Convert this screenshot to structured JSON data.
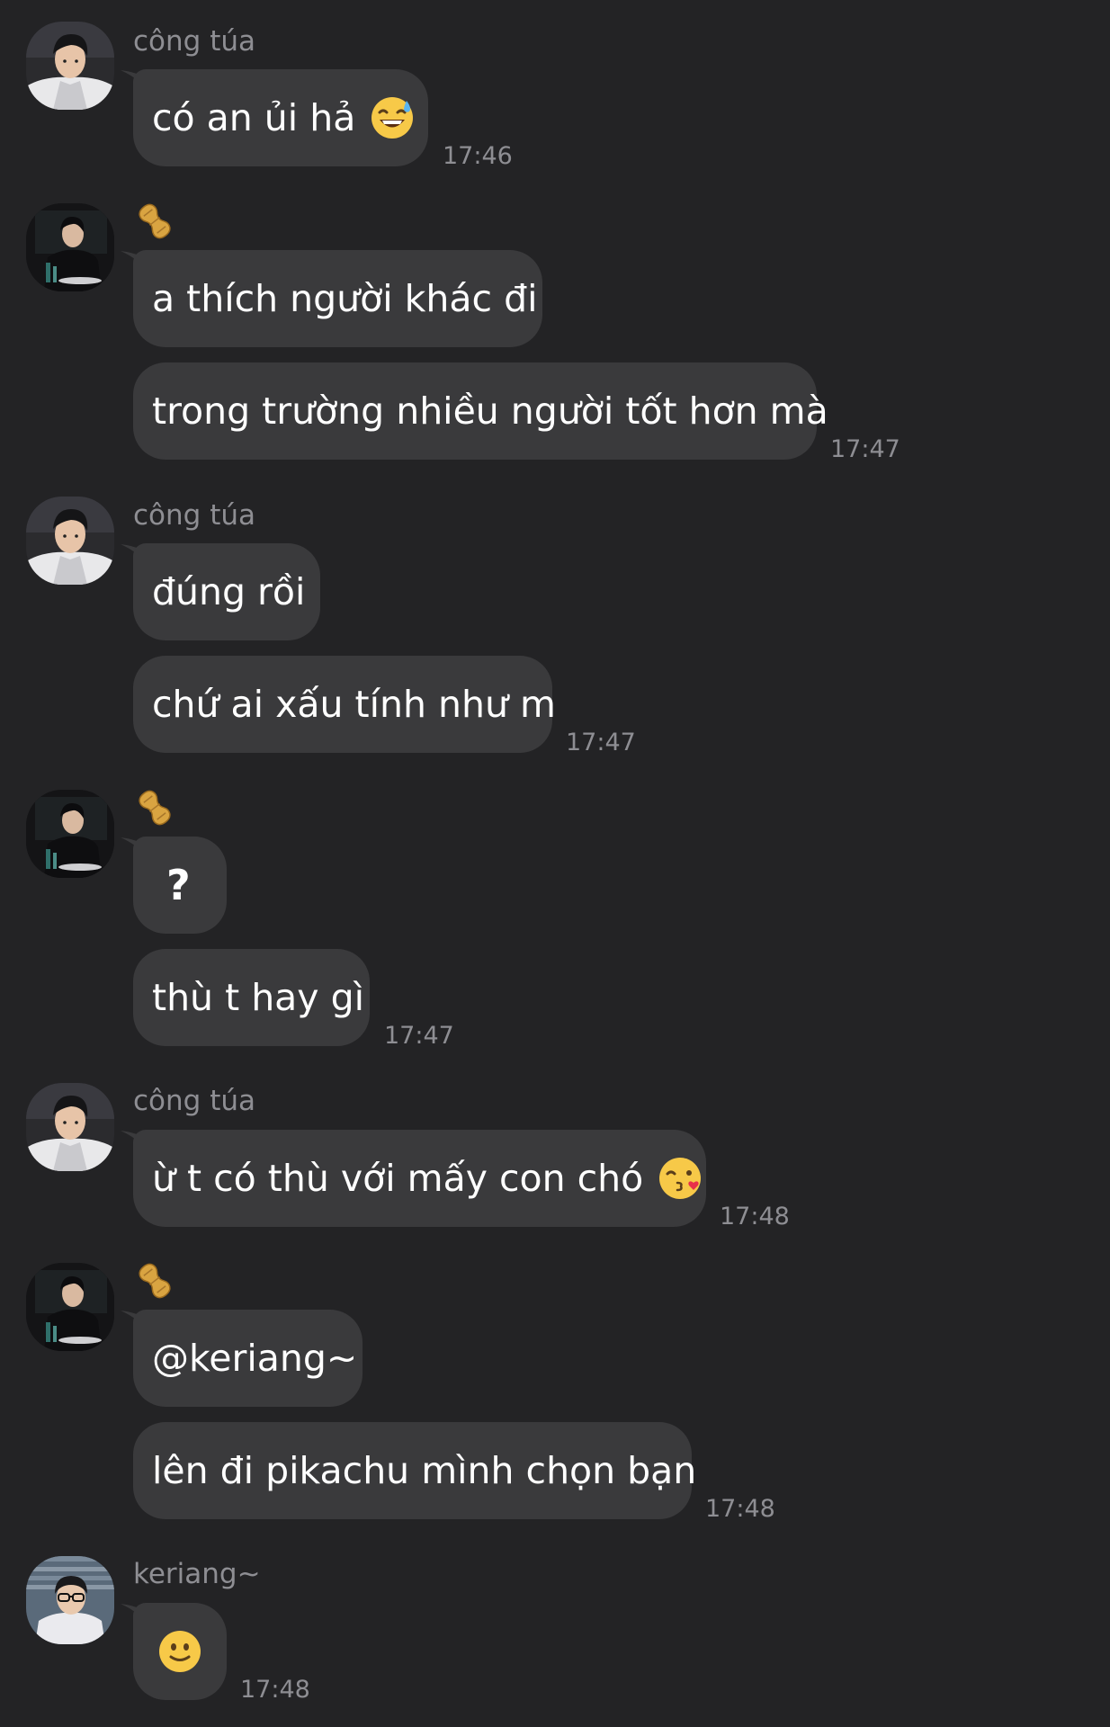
{
  "colors": {
    "background": "#232325",
    "bubble": "#3a3a3c",
    "meta_text": "#8e8e93",
    "message_text": "#ffffff"
  },
  "senders": {
    "cong_tua": {
      "name": "công túa",
      "avatar": "avatar-photo-cong-tua"
    },
    "peanut": {
      "name": "",
      "badge_icon": "peanut-icon",
      "avatar": "avatar-photo-peanut"
    },
    "keriang": {
      "name": "keriang~",
      "avatar": "avatar-photo-keriang"
    }
  },
  "messages": {
    "g1": {
      "sender": "công túa",
      "bubbles": [
        {
          "text": "có an ủi hả",
          "emoji": "grinning-sweat-emoji"
        }
      ],
      "time": "17:46"
    },
    "g2": {
      "sender_icon": "peanut-icon",
      "bubbles": [
        {
          "text": "a thích người khác đi"
        },
        {
          "text": "trong trường nhiều người tốt hơn mà"
        }
      ],
      "time": "17:47"
    },
    "g3": {
      "sender": "công túa",
      "bubbles": [
        {
          "text": "đúng rồi"
        },
        {
          "text": "chứ ai xấu tính như m"
        }
      ],
      "time": "17:47"
    },
    "g4": {
      "sender_icon": "peanut-icon",
      "bubbles": [
        {
          "text": "?"
        },
        {
          "text": "thù t hay gì"
        }
      ],
      "time": "17:47"
    },
    "g5": {
      "sender": "công túa",
      "bubbles": [
        {
          "text": "ừ t có thù với mấy con chó",
          "emoji": "kissing-heart-emoji"
        }
      ],
      "time": "17:48"
    },
    "g6": {
      "sender_icon": "peanut-icon",
      "bubbles": [
        {
          "text": "@keriang~"
        },
        {
          "text": "lên đi pikachu mình chọn bạn"
        }
      ],
      "time": "17:48"
    },
    "g7": {
      "sender": "keriang~",
      "bubbles": [
        {
          "emoji": "slightly-smiling-emoji"
        }
      ],
      "time": "17:48"
    }
  }
}
